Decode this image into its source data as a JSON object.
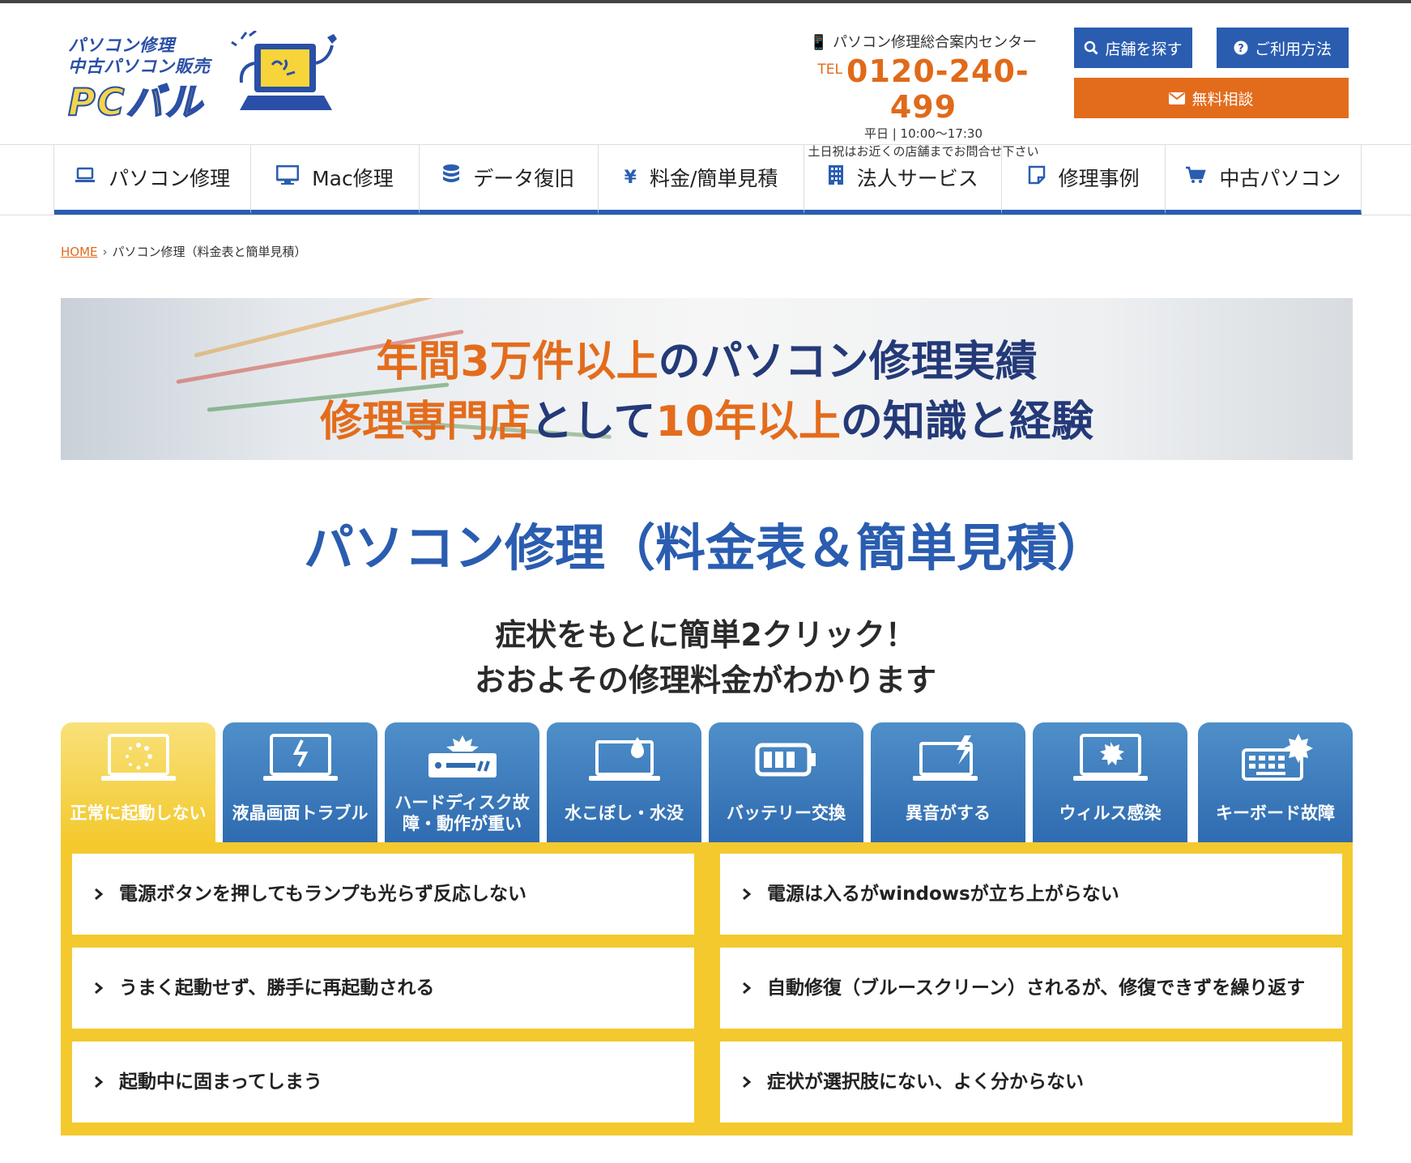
{
  "header": {
    "logo": {
      "line1": "パソコン修理",
      "line2": "中古パソコン販売",
      "brand": "PCバル"
    },
    "contact": {
      "center_name": "パソコン修理総合案内センター",
      "tel_label": "TEL",
      "tel_number": "0120-240-499",
      "hours": "平日 | 10:00〜17:30",
      "note": "土日祝はお近くの店舗までお問合せ下さい"
    },
    "buttons": {
      "store": "店舗を探す",
      "usage": "ご利用方法",
      "consult": "無料相談"
    }
  },
  "nav": {
    "items": [
      {
        "label": "パソコン修理",
        "icon": "laptop-icon"
      },
      {
        "label": "Mac修理",
        "icon": "desktop-icon"
      },
      {
        "label": "データ復旧",
        "icon": "database-icon"
      },
      {
        "label": "料金/簡単見積",
        "icon": "yen-icon"
      },
      {
        "label": "法人サービス",
        "icon": "building-icon"
      },
      {
        "label": "修理事例",
        "icon": "note-icon"
      },
      {
        "label": "中古パソコン",
        "icon": "cart-icon"
      }
    ]
  },
  "breadcrumb": {
    "home": "HOME",
    "current": "パソコン修理（料金表と簡単見積）"
  },
  "banner": {
    "line1": {
      "a": "年間3万件以上",
      "b": "のパソコン修理実績"
    },
    "line2": {
      "a": "修理専門店",
      "b": "として",
      "c": "10年以上",
      "d": "の知識と経験"
    }
  },
  "page_title": "パソコン修理（料金表＆簡単見積）",
  "subtitle": {
    "line1": "症状をもとに簡単2クリック！",
    "line2": "おおよその修理料金がわかります"
  },
  "tabs": [
    {
      "label": "正常に起動しない",
      "icon": "laptop-loading-icon",
      "active": true
    },
    {
      "label": "液晶画面トラブル",
      "icon": "broken-screen-icon",
      "active": false
    },
    {
      "label": "ハードディスク故障・動作が重い",
      "icon": "hdd-icon",
      "active": false
    },
    {
      "label": "水こぼし・水没",
      "icon": "water-drop-laptop-icon",
      "active": false
    },
    {
      "label": "バッテリー交換",
      "icon": "battery-icon",
      "active": false
    },
    {
      "label": "異音がする",
      "icon": "noise-laptop-icon",
      "active": false
    },
    {
      "label": "ウィルス感染",
      "icon": "virus-monitor-icon",
      "active": false
    },
    {
      "label": "キーボード故障",
      "icon": "keyboard-icon",
      "active": false
    }
  ],
  "symptoms": [
    "電源ボタンを押してもランプも光らず反応しない",
    "電源は入るがwindowsが立ち上がらない",
    "うまく起動せず、勝手に再起動される",
    "自動修復（ブルースクリーン）されるが、修復できずを繰り返す",
    "起動中に固まってしまう",
    "症状が選択肢にない、よく分からない"
  ],
  "colors": {
    "brand_blue": "#2a5db0",
    "accent_orange": "#e36c1c",
    "panel_yellow": "#f3c92e"
  }
}
